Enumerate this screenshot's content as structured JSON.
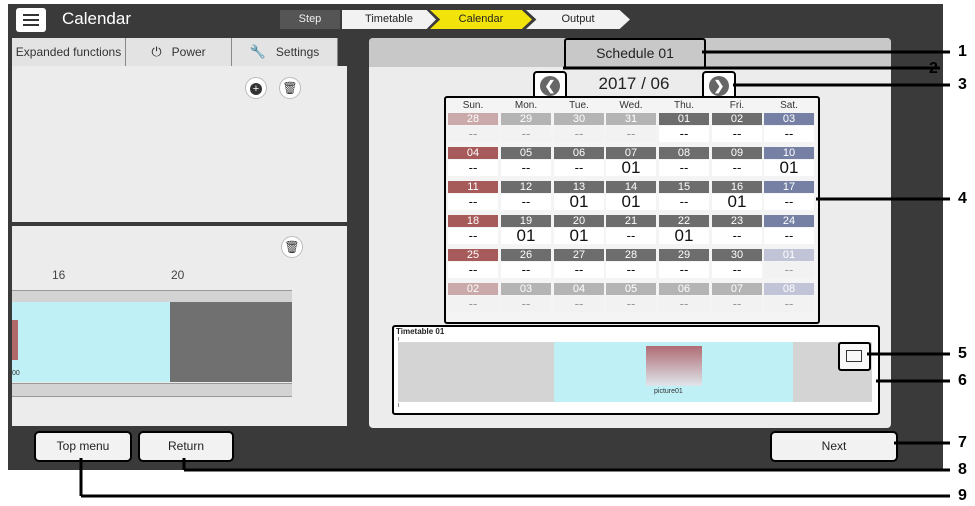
{
  "header": {
    "title": "Calendar"
  },
  "steps": {
    "label": "Step",
    "items": [
      "Timetable",
      "Calendar",
      "Output"
    ]
  },
  "tabs": [
    {
      "label": "Expanded functions",
      "icon": ""
    },
    {
      "label": "Power",
      "icon": "power-icon"
    },
    {
      "label": "Settings",
      "icon": "wrench-icon"
    }
  ],
  "left_timeline": {
    "ticks": [
      "16",
      "20"
    ],
    "clip_text": "00"
  },
  "schedule": {
    "title": "Schedule 01",
    "month": "2017 / 06"
  },
  "calendar": {
    "weekdays": [
      "Sun.",
      "Mon.",
      "Tue.",
      "Wed.",
      "Thu.",
      "Fri.",
      "Sat."
    ],
    "weeks": [
      [
        {
          "d": "28",
          "v": "--",
          "c": "#c9a9a9",
          "o": true
        },
        {
          "d": "29",
          "v": "--",
          "c": "#b4b4b4",
          "o": true
        },
        {
          "d": "30",
          "v": "--",
          "c": "#b4b4b4",
          "o": true
        },
        {
          "d": "31",
          "v": "--",
          "c": "#b4b4b4",
          "o": true
        },
        {
          "d": "01",
          "v": "--",
          "c": "#6d6d6d"
        },
        {
          "d": "02",
          "v": "--",
          "c": "#6d6d6d"
        },
        {
          "d": "03",
          "v": "--",
          "c": "#7580a4"
        }
      ],
      [
        {
          "d": "04",
          "v": "--",
          "c": "#a65a5a"
        },
        {
          "d": "05",
          "v": "--",
          "c": "#6d6d6d"
        },
        {
          "d": "06",
          "v": "--",
          "c": "#6d6d6d"
        },
        {
          "d": "07",
          "v": "01",
          "c": "#6d6d6d"
        },
        {
          "d": "08",
          "v": "--",
          "c": "#6d6d6d"
        },
        {
          "d": "09",
          "v": "--",
          "c": "#6d6d6d"
        },
        {
          "d": "10",
          "v": "01",
          "c": "#7580a4"
        }
      ],
      [
        {
          "d": "11",
          "v": "--",
          "c": "#a65a5a"
        },
        {
          "d": "12",
          "v": "--",
          "c": "#6d6d6d"
        },
        {
          "d": "13",
          "v": "01",
          "c": "#6d6d6d"
        },
        {
          "d": "14",
          "v": "01",
          "c": "#6d6d6d"
        },
        {
          "d": "15",
          "v": "--",
          "c": "#6d6d6d"
        },
        {
          "d": "16",
          "v": "01",
          "c": "#6d6d6d"
        },
        {
          "d": "17",
          "v": "--",
          "c": "#7580a4"
        }
      ],
      [
        {
          "d": "18",
          "v": "--",
          "c": "#a65a5a"
        },
        {
          "d": "19",
          "v": "01",
          "c": "#6d6d6d"
        },
        {
          "d": "20",
          "v": "01",
          "c": "#6d6d6d"
        },
        {
          "d": "21",
          "v": "--",
          "c": "#6d6d6d"
        },
        {
          "d": "22",
          "v": "01",
          "c": "#6d6d6d"
        },
        {
          "d": "23",
          "v": "--",
          "c": "#6d6d6d"
        },
        {
          "d": "24",
          "v": "--",
          "c": "#7580a4"
        }
      ],
      [
        {
          "d": "25",
          "v": "--",
          "c": "#a65a5a"
        },
        {
          "d": "26",
          "v": "--",
          "c": "#6d6d6d"
        },
        {
          "d": "27",
          "v": "--",
          "c": "#6d6d6d"
        },
        {
          "d": "28",
          "v": "--",
          "c": "#6d6d6d"
        },
        {
          "d": "29",
          "v": "--",
          "c": "#6d6d6d"
        },
        {
          "d": "30",
          "v": "--",
          "c": "#6d6d6d"
        },
        {
          "d": "01",
          "v": "--",
          "c": "#c0c4d6",
          "o": true
        }
      ],
      [
        {
          "d": "02",
          "v": "--",
          "c": "#c9a9a9",
          "o": true
        },
        {
          "d": "03",
          "v": "--",
          "c": "#b4b4b4",
          "o": true
        },
        {
          "d": "04",
          "v": "--",
          "c": "#b4b4b4",
          "o": true
        },
        {
          "d": "05",
          "v": "--",
          "c": "#b4b4b4",
          "o": true
        },
        {
          "d": "06",
          "v": "--",
          "c": "#b4b4b4",
          "o": true
        },
        {
          "d": "07",
          "v": "--",
          "c": "#b4b4b4",
          "o": true
        },
        {
          "d": "08",
          "v": "--",
          "c": "#c0c4d6",
          "o": true
        }
      ]
    ]
  },
  "timetable": {
    "title": "Timetable 01",
    "clip_label": "picture01"
  },
  "buttons": {
    "top_menu": "Top menu",
    "return": "Return",
    "next": "Next"
  },
  "callouts": [
    "1",
    "2",
    "3",
    "4",
    "5",
    "6",
    "7",
    "8",
    "9"
  ]
}
